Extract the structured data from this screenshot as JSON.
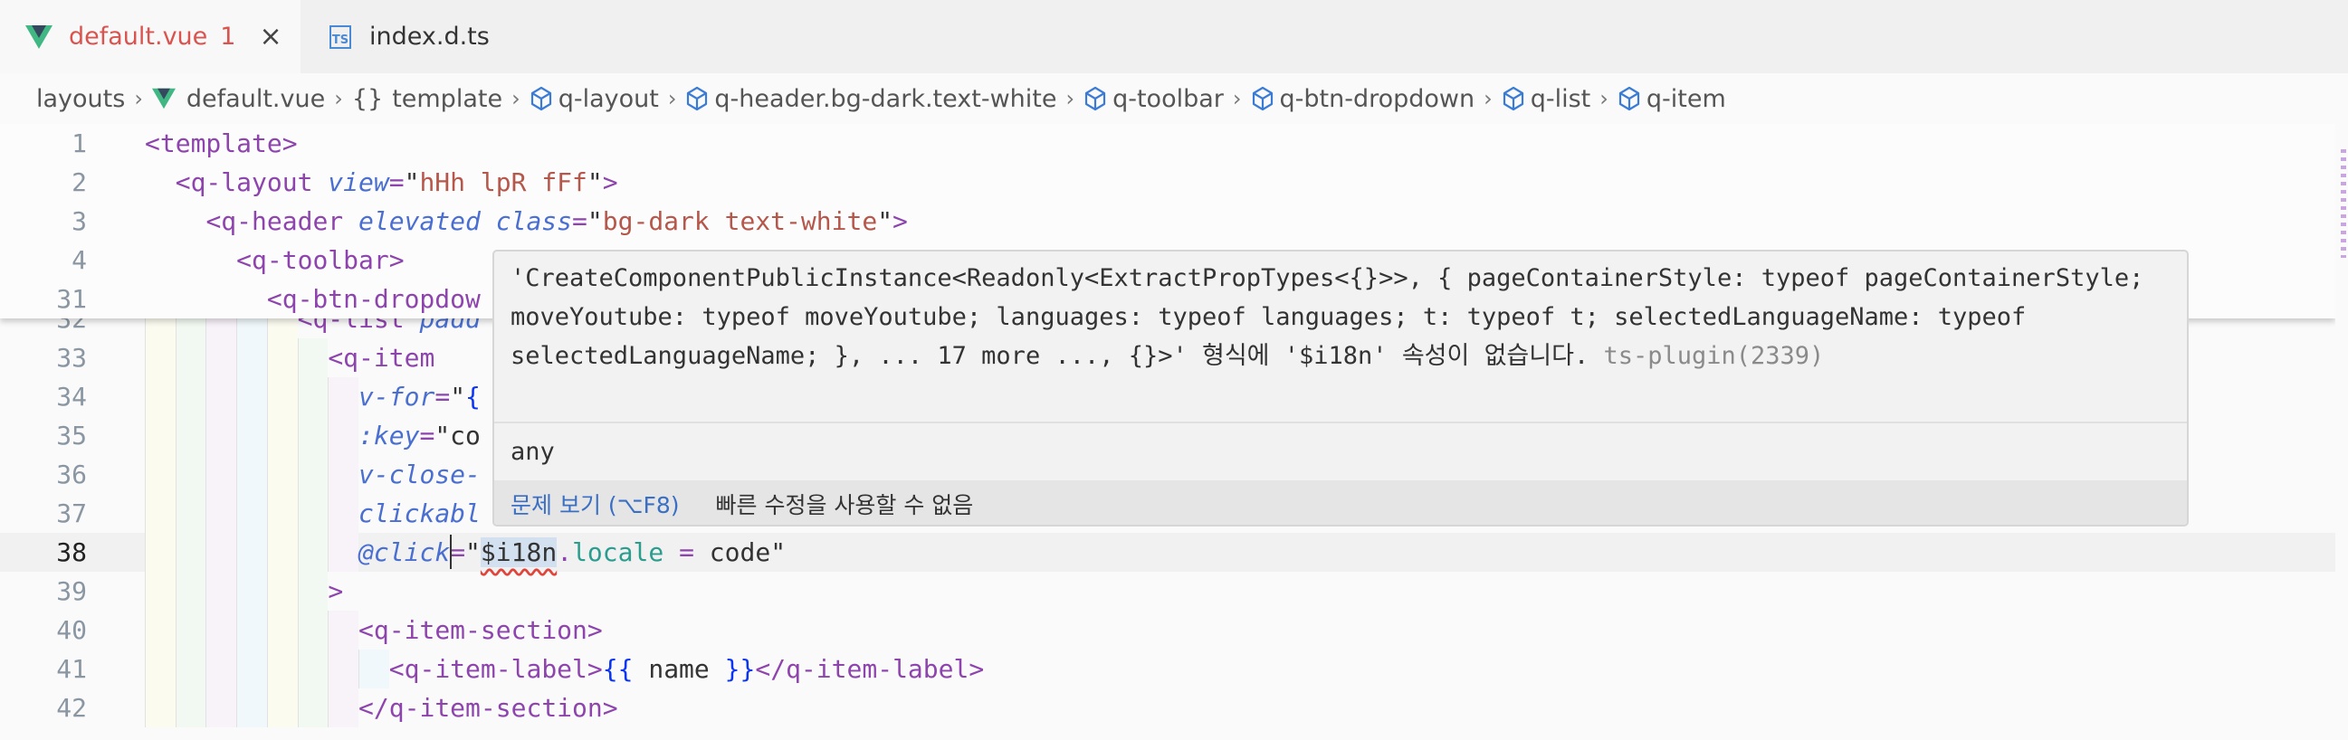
{
  "tabs": [
    {
      "label": "default.vue",
      "badge": "1",
      "icon": "vue-icon",
      "active": true,
      "close": "×"
    },
    {
      "label": "index.d.ts",
      "icon": "typescript-icon",
      "icon_text": "TS",
      "active": false
    }
  ],
  "breadcrumb": [
    {
      "label": "layouts",
      "icon": ""
    },
    {
      "label": "default.vue",
      "icon": "vue-icon"
    },
    {
      "label": "template",
      "icon": "braces-icon",
      "icon_text": "{}"
    },
    {
      "label": "q-layout",
      "icon": "cube-icon"
    },
    {
      "label": "q-header.bg-dark.text-white",
      "icon": "cube-icon"
    },
    {
      "label": "q-toolbar",
      "icon": "cube-icon"
    },
    {
      "label": "q-btn-dropdown",
      "icon": "cube-icon"
    },
    {
      "label": "q-list",
      "icon": "cube-icon"
    },
    {
      "label": "q-item",
      "icon": "cube-icon"
    }
  ],
  "sticky_lines": [
    {
      "n": "1",
      "tokens": [
        [
          "tag",
          "<template>"
        ]
      ]
    },
    {
      "n": "2",
      "tokens": [
        [
          "plain",
          "  "
        ],
        [
          "tag",
          "<q-layout"
        ],
        [
          "plain",
          " "
        ],
        [
          "attr",
          "view"
        ],
        [
          "eq",
          "="
        ],
        [
          "plain",
          "\""
        ],
        [
          "str",
          "hHh lpR fFf"
        ],
        [
          "plain",
          "\""
        ],
        [
          "tag",
          ">"
        ]
      ]
    },
    {
      "n": "3",
      "tokens": [
        [
          "plain",
          "    "
        ],
        [
          "tag",
          "<q-header"
        ],
        [
          "plain",
          " "
        ],
        [
          "attr",
          "elevated"
        ],
        [
          "plain",
          " "
        ],
        [
          "attr",
          "class"
        ],
        [
          "eq",
          "="
        ],
        [
          "plain",
          "\""
        ],
        [
          "str",
          "bg-dark text-white"
        ],
        [
          "plain",
          "\""
        ],
        [
          "tag",
          ">"
        ]
      ]
    },
    {
      "n": "4",
      "tokens": [
        [
          "plain",
          "      "
        ],
        [
          "tag",
          "<q-toolbar>"
        ]
      ]
    },
    {
      "n": "31",
      "tokens": [
        [
          "plain",
          "        "
        ],
        [
          "tag",
          "<q-btn-dropdow"
        ]
      ]
    }
  ],
  "lines": [
    {
      "n": "32",
      "tokens": [
        [
          "plain",
          "          "
        ],
        [
          "tag",
          "<q-list"
        ],
        [
          "plain",
          " "
        ],
        [
          "attr",
          "padd"
        ]
      ]
    },
    {
      "n": "33",
      "tokens": [
        [
          "plain",
          "            "
        ],
        [
          "tag",
          "<q-item"
        ]
      ]
    },
    {
      "n": "34",
      "tokens": [
        [
          "plain",
          "              "
        ],
        [
          "attr",
          "v-for"
        ],
        [
          "eq",
          "="
        ],
        [
          "plain",
          "\""
        ],
        [
          "brace",
          "{"
        ]
      ]
    },
    {
      "n": "35",
      "tokens": [
        [
          "plain",
          "              "
        ],
        [
          "attr",
          ":key"
        ],
        [
          "eq",
          "="
        ],
        [
          "plain",
          "\"co"
        ]
      ]
    },
    {
      "n": "36",
      "tokens": [
        [
          "plain",
          "              "
        ],
        [
          "attr",
          "v-close-"
        ]
      ]
    },
    {
      "n": "37",
      "tokens": [
        [
          "plain",
          "              "
        ],
        [
          "attr",
          "clickabl"
        ]
      ]
    },
    {
      "n": "38",
      "current": true,
      "tokens": [
        [
          "plain",
          "              "
        ],
        [
          "attr",
          "@click"
        ],
        [
          "eq",
          "="
        ],
        [
          "plain",
          "\""
        ],
        [
          "err",
          "$i18n"
        ],
        [
          "dot",
          "."
        ],
        [
          "prop",
          "locale"
        ],
        [
          "plain",
          " "
        ],
        [
          "eq",
          "="
        ],
        [
          "plain",
          " code\""
        ]
      ]
    },
    {
      "n": "39",
      "tokens": [
        [
          "plain",
          "            "
        ],
        [
          "tag",
          ">"
        ]
      ]
    },
    {
      "n": "40",
      "tokens": [
        [
          "plain",
          "              "
        ],
        [
          "tag",
          "<q-item-section>"
        ]
      ]
    },
    {
      "n": "41",
      "tokens": [
        [
          "plain",
          "                "
        ],
        [
          "tag",
          "<q-item-label>"
        ],
        [
          "brace",
          "{{"
        ],
        [
          "plain",
          " name "
        ],
        [
          "brace",
          "}}"
        ],
        [
          "tag",
          "</q-item-label>"
        ]
      ]
    },
    {
      "n": "42",
      "tokens": [
        [
          "plain",
          "              "
        ],
        [
          "tag",
          "</q-item-section>"
        ]
      ]
    }
  ],
  "hover": {
    "message": "'CreateComponentPublicInstance<Readonly<ExtractPropTypes<{}>>, { pageContainerStyle: typeof pageContainerStyle; moveYoutube: typeof moveYoutube; languages: typeof languages; t: typeof t; selectedLanguageName: typeof selectedLanguageName; }, ... 17 more ..., {}>' 형식에 '$i18n' 속성이 없습니다.",
    "source": "ts-plugin(2339)",
    "type": "any",
    "view_problem": "문제 보기 (⌥F8)",
    "no_quick_fix": "빠른 수정을 사용할 수 없음"
  },
  "colors": {
    "tag": "#8e44ad",
    "attr": "#4a6fd0",
    "string": "#b5574a",
    "error_tab": "#d9534f",
    "link": "#3a6fc4"
  }
}
